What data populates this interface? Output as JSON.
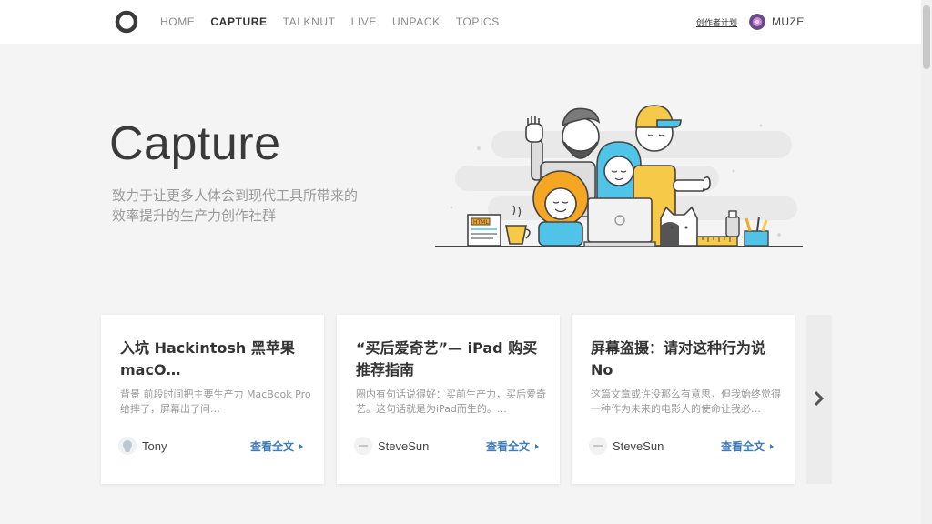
{
  "header": {
    "nav": [
      {
        "label": "HOME",
        "active": false
      },
      {
        "label": "CAPTURE",
        "active": true
      },
      {
        "label": "TALKNUT",
        "active": false
      },
      {
        "label": "LIVE",
        "active": false
      },
      {
        "label": "UNPACK",
        "active": false
      },
      {
        "label": "TOPICS",
        "active": false
      }
    ],
    "creator_link": "创作者计划",
    "username": "MUZE"
  },
  "hero": {
    "title": "Capture",
    "subtitle": "致力于让更多人体会到现代工具所带来的效率提升的生产力创作社群",
    "illustration_labels": {
      "html": "HTML"
    }
  },
  "cards": [
    {
      "title": "入坑 Hackintosh 黑苹果 macO…",
      "excerpt": "背景 前段时间把主要生产力 MacBook Pro 给摔了，屏幕出了问…",
      "author": "Tony",
      "read_more": "查看全文"
    },
    {
      "title": "“买后爱奇艺”— iPad 购买推荐指南",
      "excerpt": "圈内有句话说得好：买前生产力，买后爱奇艺。这句话就是为iPad而生的。…",
      "author": "SteveSun",
      "read_more": "查看全文"
    },
    {
      "title": "屏幕盗摄：请对这种行为说 No",
      "excerpt": "这篇文章或许没那么有意思，但我始终觉得一种作为未来的电影人的使命让我必…",
      "author": "SteveSun",
      "read_more": "查看全文"
    }
  ],
  "colors": {
    "accent": "#3d7ab8",
    "hair_orange": "#f5a623",
    "cyan": "#4fc3e8",
    "yellow": "#f7c948"
  }
}
